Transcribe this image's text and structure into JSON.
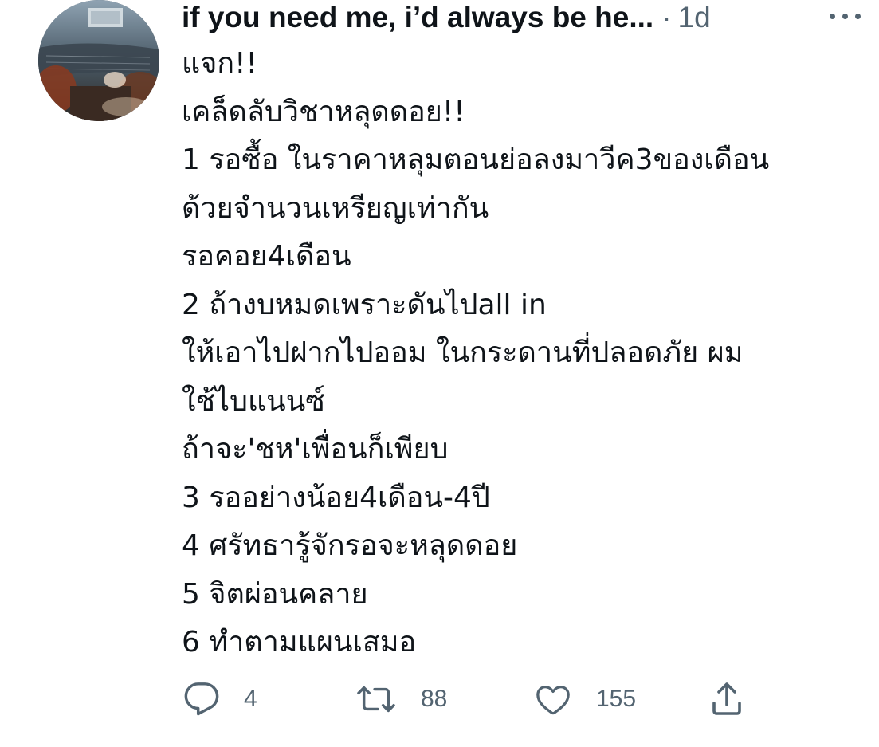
{
  "tweet": {
    "display_name": "if you need me, i’d always be he...",
    "separator": "·",
    "time": "1d",
    "lines": [
      "แจก!!",
      "เคล็ดลับวิชาหลุดดอย!!",
      "1 รอซื้อ ในราคาหลุมตอนย่อลงมาวีค3ของเดือน",
      "ด้วยจำนวนเหรียญเท่ากัน",
      "รอคอย4เดือน",
      "2 ถ้างบหมดเพราะดันไปall in",
      "ให้เอาไปฝากไปออม ในกระดานที่ปลอดภัย ผม",
      "ใช้ไบแนนซ์",
      "ถ้าจะ'ชห'เพื่อนก็เพียบ",
      "3 รออย่างน้อย4เดือน-4ปี",
      "4 ศรัทธารู้จักรอจะหลุดดอย",
      "5 จิตผ่อนคลาย",
      "6 ทำตามแผนเสมอ"
    ],
    "actions": {
      "reply_count": "4",
      "retweet_count": "88",
      "like_count": "155"
    }
  },
  "icons": {
    "reply": "reply-bubble-icon",
    "retweet": "retweet-arrows-icon",
    "like": "heart-icon",
    "share": "share-upload-icon",
    "more": "more-dots-icon"
  },
  "colors": {
    "text": "#0f1419",
    "secondary": "#536471",
    "background": "#ffffff"
  }
}
